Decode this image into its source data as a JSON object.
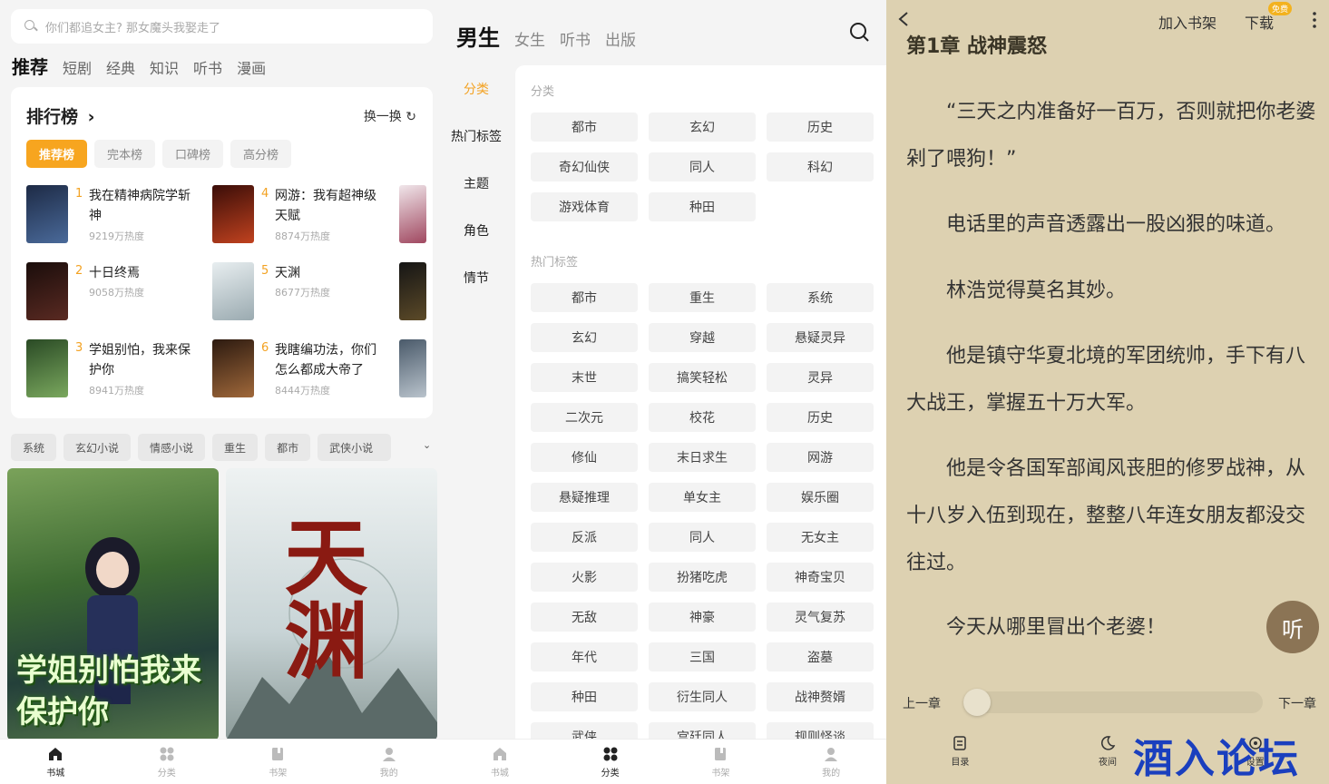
{
  "store": {
    "search_placeholder": "你们都追女主? 那女魔头我娶走了",
    "tabs": [
      "推荐",
      "短剧",
      "经典",
      "知识",
      "听书",
      "漫画"
    ],
    "rank": {
      "title": "排行榜",
      "arrow": "›",
      "refresh": "换一换",
      "refresh_icon": "refresh-icon",
      "chips": [
        "推荐榜",
        "完本榜",
        "口碑榜",
        "高分榜"
      ],
      "items": [
        {
          "no": "1",
          "name": "我在精神病院学斩神",
          "heat": "9219万热度",
          "cover": "#2c3e5b"
        },
        {
          "no": "2",
          "name": "十日终焉",
          "heat": "9058万热度",
          "cover": "#3a2320"
        },
        {
          "no": "3",
          "name": "学姐别怕，我来保护你",
          "heat": "8941万热度",
          "cover": "#3e6b3a"
        },
        {
          "no": "4",
          "name": "网游：我有超神级天赋",
          "heat": "8874万热度",
          "cover": "#7a2418"
        },
        {
          "no": "5",
          "name": "天渊",
          "heat": "8677万热度",
          "cover": "#c9d3d6"
        },
        {
          "no": "6",
          "name": "我瞎编功法，你们怎么都成大帝了",
          "heat": "8444万热度",
          "cover": "#5a3a25"
        }
      ]
    },
    "tags": [
      "系统",
      "玄幻小说",
      "情感小说",
      "重生",
      "都市",
      "武侠小说"
    ],
    "featured": [
      {
        "title": "学姐别怕我来保护你",
        "color": "#4f7a3d"
      },
      {
        "title": "天渊",
        "color": "#dfe6e8"
      }
    ]
  },
  "nav": [
    "书城",
    "分类",
    "书架",
    "我的"
  ],
  "category": {
    "tabs": [
      "男生",
      "女生",
      "听书",
      "出版"
    ],
    "side": [
      "分类",
      "热门标签",
      "主题",
      "角色",
      "情节"
    ],
    "section1_title": "分类",
    "section1": [
      "都市",
      "玄幻",
      "历史",
      "奇幻仙侠",
      "同人",
      "科幻",
      "游戏体育",
      "种田"
    ],
    "section2_title": "热门标签",
    "section2": [
      "都市",
      "重生",
      "系统",
      "玄幻",
      "穿越",
      "悬疑灵异",
      "末世",
      "搞笑轻松",
      "灵异",
      "二次元",
      "校花",
      "历史",
      "修仙",
      "末日求生",
      "网游",
      "悬疑推理",
      "单女主",
      "娱乐圈",
      "反派",
      "同人",
      "无女主",
      "火影",
      "扮猪吃虎",
      "神奇宝贝",
      "无敌",
      "神豪",
      "灵气复苏",
      "年代",
      "三国",
      "盗墓",
      "种田",
      "衍生同人",
      "战神赘婿",
      "武侠",
      "宫廷同人",
      "规则怪谈"
    ]
  },
  "reader": {
    "add_shelf": "加入书架",
    "download": "下载",
    "free_badge": "免费",
    "chapter_title": "第1章 战神震怒",
    "paragraphs": [
      "“三天之内准备好一百万，否则就把你老婆剁了喂狗！”",
      "电话里的声音透露出一股凶狠的味道。",
      "林浩觉得莫名其妙。",
      "他是镇守华夏北境的军团统帅，手下有八大战王，掌握五十万大军。",
      "他是令各国军部闻风丧胆的修罗战神，从十八岁入伍到现在，整整八年连女朋友都没交往过。",
      "今天从哪里冒出个老婆！"
    ],
    "listen": "听",
    "prev": "上一章",
    "next": "下一章",
    "progress": 0,
    "nav": [
      "目录",
      "夜间",
      "设置"
    ],
    "watermark": "酒入论坛"
  },
  "colors": {
    "accent": "#f3a222",
    "reader_bg": "#ddd1b1",
    "watermark": "#1a3fbe"
  }
}
